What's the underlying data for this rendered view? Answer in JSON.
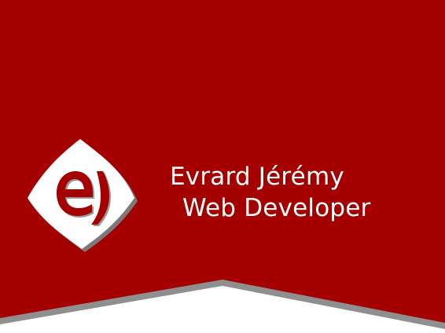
{
  "colors": {
    "banner": "#a50000",
    "banner_edge_shadow": "#8f8f8f",
    "text": "#ffffff",
    "logo_fill": "#ffffff",
    "logo_mark": "#a50000",
    "logo_shadow": "#7a7a7a"
  },
  "logo": {
    "icon": "ej-monogram-logo"
  },
  "header": {
    "name": "Evrard Jérémy",
    "role": "Web Developer"
  }
}
